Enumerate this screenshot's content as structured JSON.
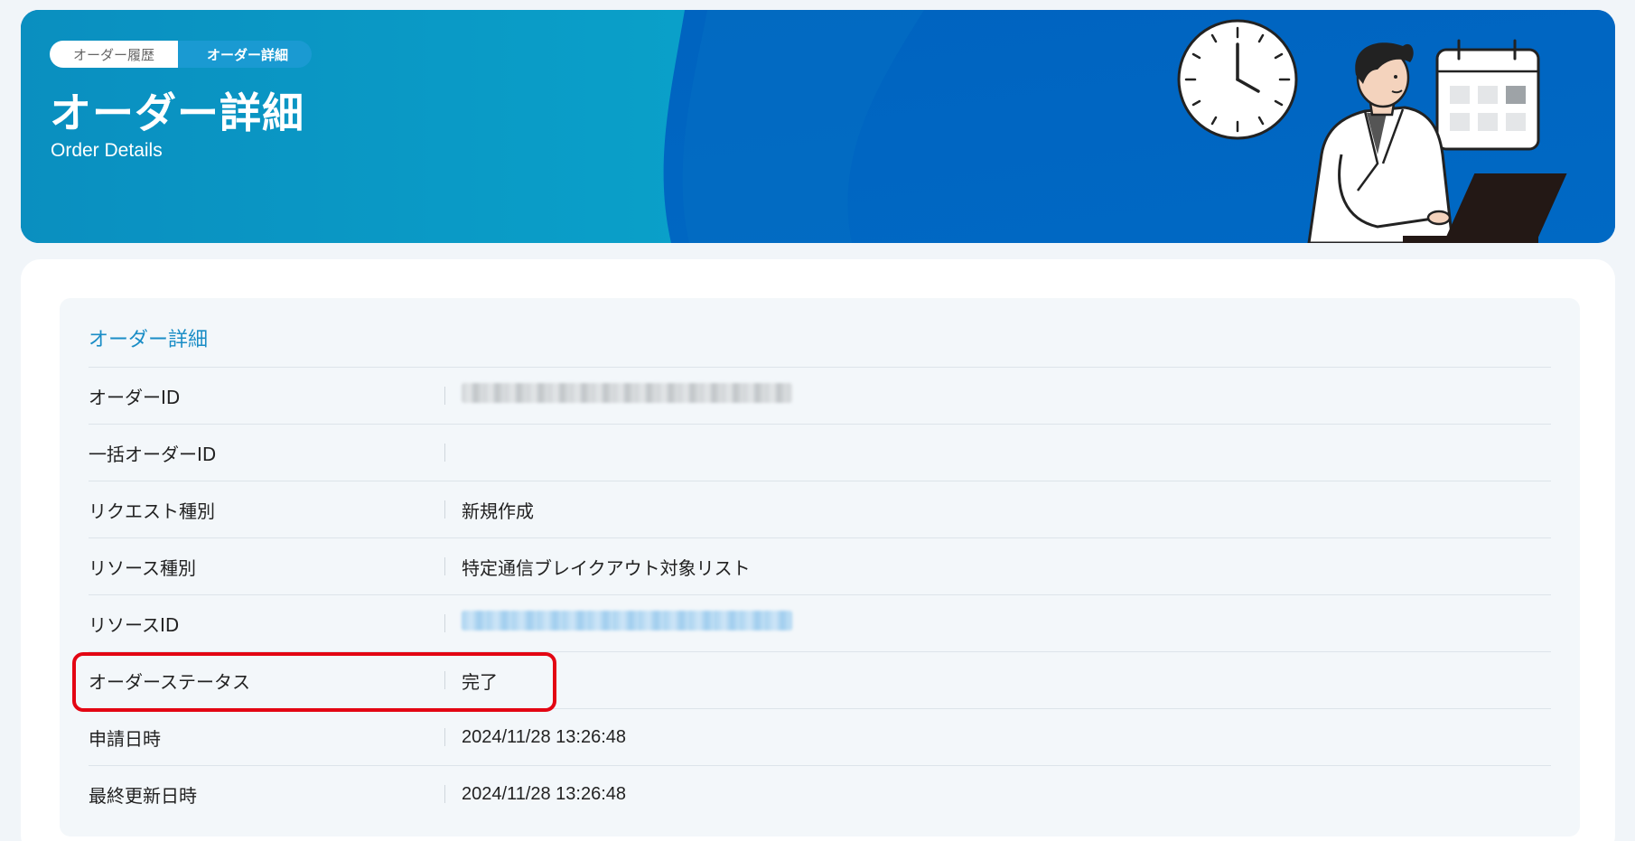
{
  "breadcrumb": {
    "items": [
      "オーダー履歴",
      "オーダー詳細"
    ]
  },
  "header": {
    "title": "オーダー詳細",
    "subtitle": "Order Details"
  },
  "detail": {
    "section_title": "オーダー詳細",
    "rows": [
      {
        "label": "オーダーID",
        "value": ""
      },
      {
        "label": "一括オーダーID",
        "value": ""
      },
      {
        "label": "リクエスト種別",
        "value": "新規作成"
      },
      {
        "label": "リソース種別",
        "value": "特定通信ブレイクアウト対象リスト"
      },
      {
        "label": "リソースID",
        "value": ""
      },
      {
        "label": "オーダーステータス",
        "value": "完了"
      },
      {
        "label": "申請日時",
        "value": "2024/11/28 13:26:48"
      },
      {
        "label": "最終更新日時",
        "value": "2024/11/28 13:26:48"
      }
    ]
  },
  "colors": {
    "accent": "#1a8dc6",
    "hero_blue": "#0066c0",
    "hero_teal": "#0099c6",
    "highlight": "#e30613"
  },
  "icons": [
    "clock-icon",
    "calendar-icon",
    "laptop-icon"
  ]
}
